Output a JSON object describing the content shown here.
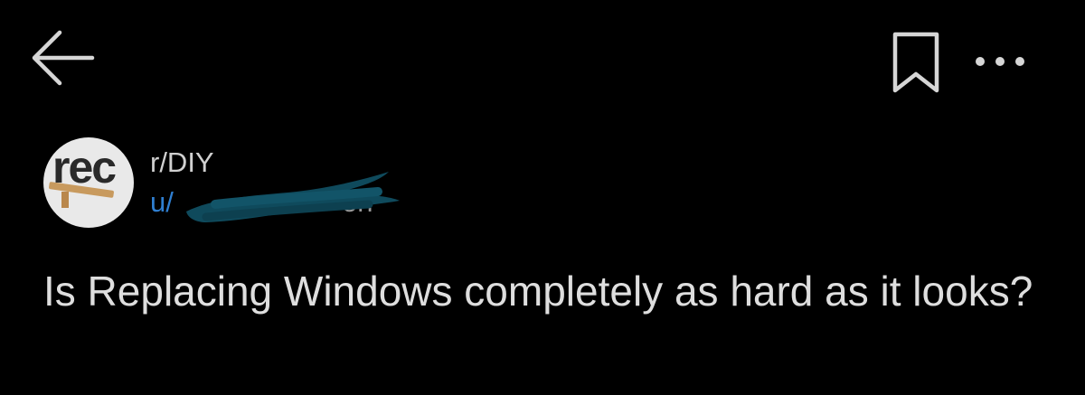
{
  "topbar": {
    "back_icon": "arrow-left-icon",
    "bookmark_icon": "bookmark-icon",
    "more_icon": "more-horizontal-icon"
  },
  "post": {
    "avatar_text": "rec",
    "subreddit": "r/DIY",
    "username_prefix": "u/",
    "username_suffix": "on",
    "title": "Is Replacing Windows completely as hard as it looks?"
  },
  "colors": {
    "background": "#000000",
    "text": "#dedede",
    "username": "#2f7fd1",
    "redaction": "#0f4a5c",
    "avatar_bg": "#e9e9e9"
  }
}
